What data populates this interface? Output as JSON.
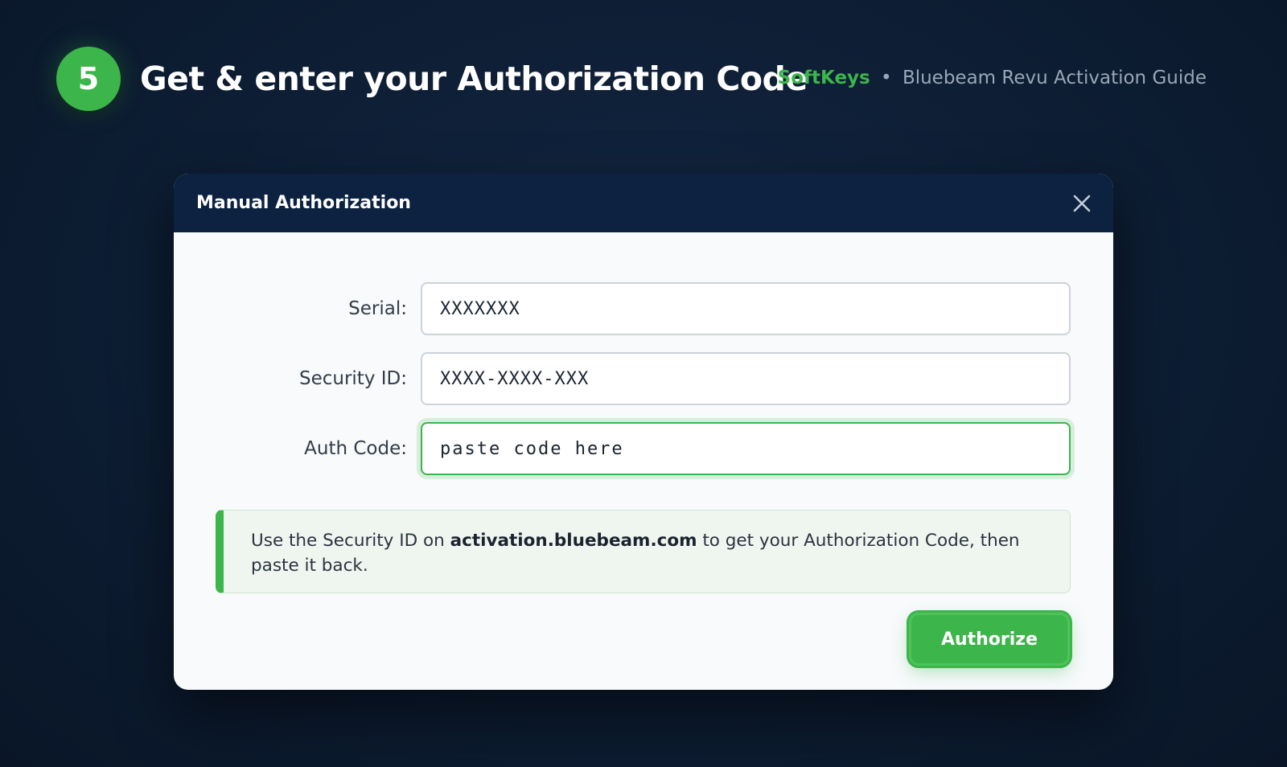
{
  "header": {
    "step_number": "5",
    "title": "Get & enter your Authorization Code",
    "brand_name": "SoftKeys",
    "brand_separator": "•",
    "guide_title": "Bluebeam Revu Activation Guide"
  },
  "dialog": {
    "title": "Manual Authorization",
    "close_icon": "close-icon",
    "fields": {
      "serial": {
        "label": "Serial:",
        "value": "XXXXXXX"
      },
      "security_id": {
        "label": "Security ID:",
        "value": "XXXX-XXXX-XXX"
      },
      "auth_code": {
        "label": "Auth Code:",
        "placeholder": "paste code here"
      }
    },
    "info": {
      "prefix": "Use the Security ID on ",
      "link": "activation.bluebeam.com",
      "suffix": " to get your Authorization Code, then paste it back."
    },
    "authorize_label": "Authorize"
  },
  "colors": {
    "accent": "#3cb54a",
    "dialog_header": "#0c2240",
    "background": "#0d1d33"
  }
}
